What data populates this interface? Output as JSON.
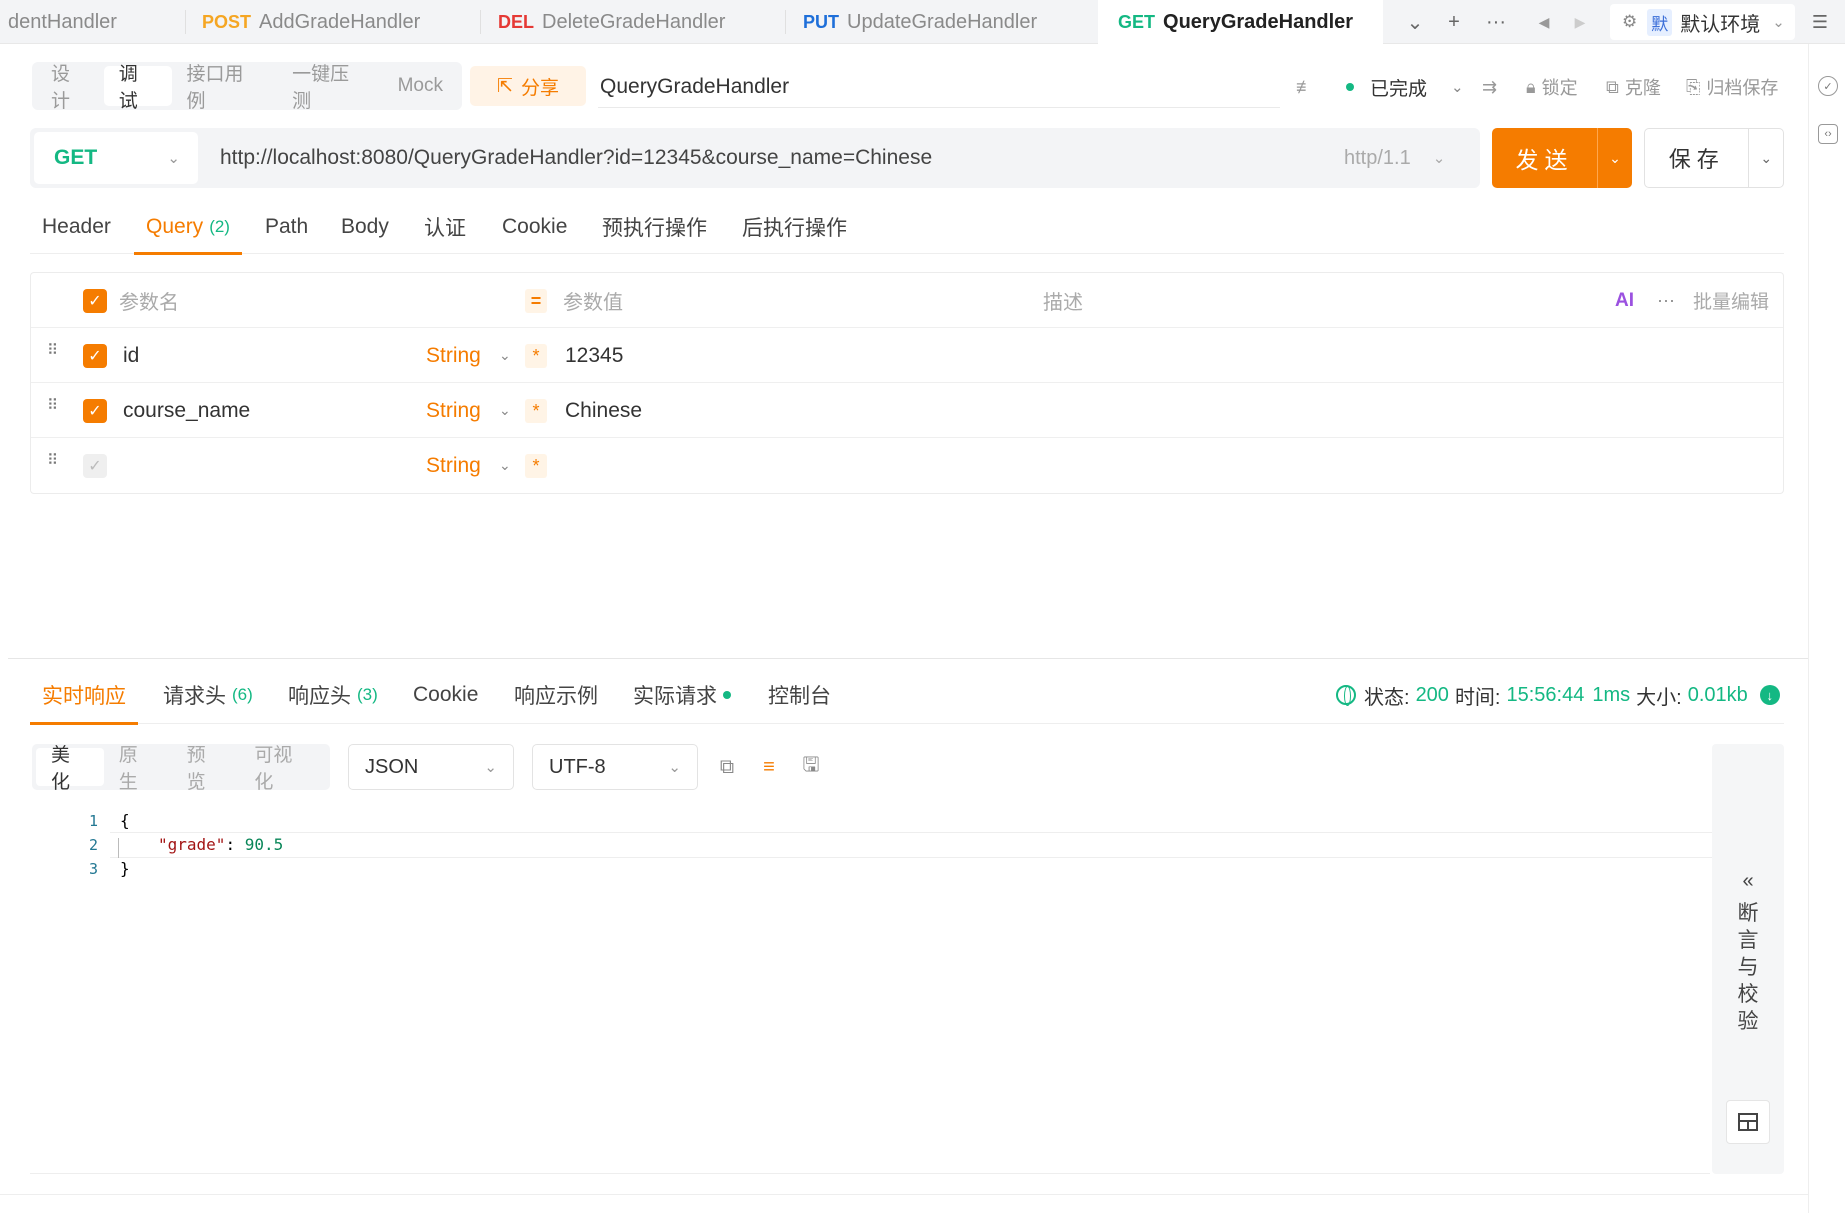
{
  "tabs": [
    {
      "method": "",
      "label": "dentHandler",
      "color": "#8a8a8a"
    },
    {
      "method": "POST",
      "label": "AddGradeHandler",
      "color": "#f5a623"
    },
    {
      "method": "DEL",
      "label": "DeleteGradeHandler",
      "color": "#e53935"
    },
    {
      "method": "PUT",
      "label": "UpdateGradeHandler",
      "color": "#1e6fd9"
    },
    {
      "method": "GET",
      "label": "QueryGradeHandler",
      "color": "#14b883"
    }
  ],
  "tabbar_icons": [
    "chevron-down-icon",
    "plus-icon",
    "more-icon",
    "arrow-left-icon",
    "arrow-right-icon"
  ],
  "env": {
    "badge": "默",
    "label": "默认环境"
  },
  "modes": [
    "设计",
    "调试",
    "接口用例",
    "一键压测",
    "Mock"
  ],
  "active_mode": "调试",
  "share_label": "分享",
  "api_name": "QueryGradeHandler",
  "status": {
    "label": "已完成",
    "color": "#14b883"
  },
  "actions": {
    "lock": "锁定",
    "clone": "克隆",
    "archive": "归档保存"
  },
  "request": {
    "method": "GET",
    "url": "http://localhost:8080/QueryGradeHandler?id=12345&course_name=Chinese",
    "http_version": "http/1.1",
    "send_label": "发送",
    "save_label": "保存"
  },
  "req_tabs": [
    {
      "label": "Header",
      "count": ""
    },
    {
      "label": "Query",
      "count": "(2)"
    },
    {
      "label": "Path",
      "count": ""
    },
    {
      "label": "Body",
      "count": ""
    },
    {
      "label": "认证",
      "count": ""
    },
    {
      "label": "Cookie",
      "count": ""
    },
    {
      "label": "预执行操作",
      "count": ""
    },
    {
      "label": "后执行操作",
      "count": ""
    }
  ],
  "params": {
    "head": {
      "name": "参数名",
      "value": "参数值",
      "desc": "描述",
      "ai": "AI",
      "bulk": "批量编辑"
    },
    "rows": [
      {
        "name": "id",
        "type": "String",
        "value": "12345",
        "checked": true
      },
      {
        "name": "course_name",
        "type": "String",
        "value": "Chinese",
        "checked": true
      },
      {
        "name": "",
        "type": "String",
        "value": "",
        "checked": false
      }
    ]
  },
  "resp_tabs": [
    {
      "label": "实时响应",
      "count": ""
    },
    {
      "label": "请求头",
      "count": "(6)"
    },
    {
      "label": "响应头",
      "count": "(3)"
    },
    {
      "label": "Cookie",
      "count": ""
    },
    {
      "label": "响应示例",
      "count": ""
    },
    {
      "label": "实际请求",
      "count": ""
    },
    {
      "label": "控制台",
      "count": ""
    }
  ],
  "resp_status": {
    "status_label": "状态:",
    "status_code": "200",
    "time_label": "时间:",
    "time": "15:56:44",
    "duration": "1ms",
    "size_label": "大小:",
    "size": "0.01kb"
  },
  "view_modes": [
    "美化",
    "原生",
    "预览",
    "可视化"
  ],
  "format": "JSON",
  "encoding": "UTF-8",
  "code_lines": [
    {
      "n": "1",
      "text": "{"
    },
    {
      "n": "2",
      "key": "\"grade\"",
      "val": "90.5"
    },
    {
      "n": "3",
      "text": "}"
    }
  ],
  "assert_panel": {
    "chevron": "«",
    "label": "断言与校验"
  }
}
